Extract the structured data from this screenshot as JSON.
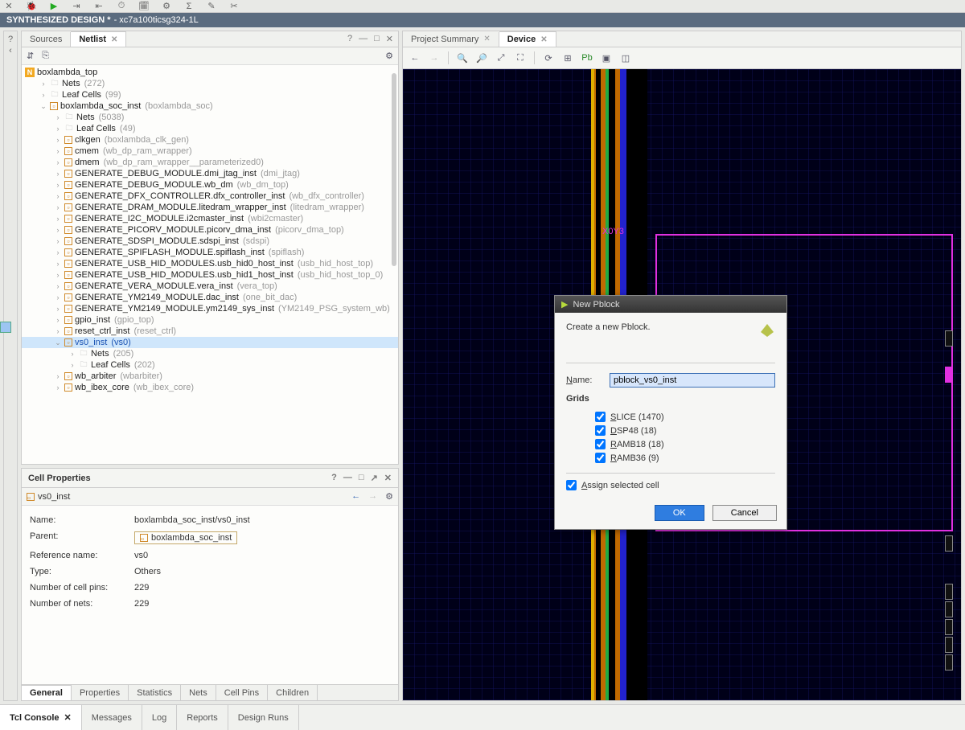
{
  "title": {
    "main": "SYNTHESIZED DESIGN *",
    "sub": "- xc7a100ticsg324-1L"
  },
  "left_tabs": {
    "t0": "Sources",
    "t1": "Netlist"
  },
  "right_tabs": {
    "t0": "Project Summary",
    "t1": "Device"
  },
  "tree": {
    "root": "boxlambda_top",
    "nets": "Nets",
    "nets_c": "(272)",
    "leaf": "Leaf Cells",
    "leaf_c": "(99)",
    "soc": "boxlambda_soc_inst",
    "soc_g": "(boxlambda_soc)",
    "soc_nets": "Nets",
    "soc_nets_c": "(5038)",
    "soc_leaf": "Leaf Cells",
    "soc_leaf_c": "(49)",
    "r0": "clkgen",
    "r0g": "(boxlambda_clk_gen)",
    "r1": "cmem",
    "r1g": "(wb_dp_ram_wrapper)",
    "r2": "dmem",
    "r2g": "(wb_dp_ram_wrapper__parameterized0)",
    "r3": "GENERATE_DEBUG_MODULE.dmi_jtag_inst",
    "r3g": "(dmi_jtag)",
    "r4": "GENERATE_DEBUG_MODULE.wb_dm",
    "r4g": "(wb_dm_top)",
    "r5": "GENERATE_DFX_CONTROLLER.dfx_controller_inst",
    "r5g": "(wb_dfx_controller)",
    "r6": "GENERATE_DRAM_MODULE.litedram_wrapper_inst",
    "r6g": "(litedram_wrapper)",
    "r7": "GENERATE_I2C_MODULE.i2cmaster_inst",
    "r7g": "(wbi2cmaster)",
    "r8": "GENERATE_PICORV_MODULE.picorv_dma_inst",
    "r8g": "(picorv_dma_top)",
    "r9": "GENERATE_SDSPI_MODULE.sdspi_inst",
    "r9g": "(sdspi)",
    "r10": "GENERATE_SPIFLASH_MODULE.spiflash_inst",
    "r10g": "(spiflash)",
    "r11": "GENERATE_USB_HID_MODULES.usb_hid0_host_inst",
    "r11g": "(usb_hid_host_top)",
    "r12": "GENERATE_USB_HID_MODULES.usb_hid1_host_inst",
    "r12g": "(usb_hid_host_top_0)",
    "r13": "GENERATE_VERA_MODULE.vera_inst",
    "r13g": "(vera_top)",
    "r14": "GENERATE_YM2149_MODULE.dac_inst",
    "r14g": "(one_bit_dac)",
    "r15": "GENERATE_YM2149_MODULE.ym2149_sys_inst",
    "r15g": "(YM2149_PSG_system_wb)",
    "r16": "gpio_inst",
    "r16g": "(gpio_top)",
    "r17": "reset_ctrl_inst",
    "r17g": "(reset_ctrl)",
    "r18": "vs0_inst",
    "r18g": "(vs0)",
    "vs_nets": "Nets",
    "vs_nets_c": "(205)",
    "vs_leaf": "Leaf Cells",
    "vs_leaf_c": "(202)",
    "r19": "wb_arbiter",
    "r19g": "(wbarbiter)",
    "r20": "wb_ibex_core",
    "r20g": "(wb_ibex_core)"
  },
  "props": {
    "title": "Cell Properties",
    "inst": "vs0_inst",
    "name_k": "Name:",
    "name_v": "boxlambda_soc_inst/vs0_inst",
    "parent_k": "Parent:",
    "parent_v": "boxlambda_soc_inst",
    "ref_k": "Reference name:",
    "ref_v": "vs0",
    "type_k": "Type:",
    "type_v": "Others",
    "pins_k": "Number of cell pins:",
    "pins_v": "229",
    "nets_k": "Number of nets:",
    "nets_v": "229",
    "tabs": {
      "t0": "General",
      "t1": "Properties",
      "t2": "Statistics",
      "t3": "Nets",
      "t4": "Cell Pins",
      "t5": "Children"
    }
  },
  "device": {
    "clock_lbl": "X0Y3"
  },
  "dialog": {
    "title": "New Pblock",
    "desc": "Create a new Pblock.",
    "name_lbl": "Name:",
    "name_val": "pblock_vs0_inst",
    "grids": "Grids",
    "g0a": "S",
    "g0b": "LICE (1470)",
    "g1a": "D",
    "g1b": "SP48 (18)",
    "g2a": "R",
    "g2b": "AMB18 (18)",
    "g3a": "R",
    "g3b": "AMB36 (9)",
    "assign_a": "A",
    "assign_b": "ssign selected cell",
    "ok": "OK",
    "cancel": "Cancel"
  },
  "bottom": {
    "t0": "Tcl Console",
    "t1": "Messages",
    "t2": "Log",
    "t3": "Reports",
    "t4": "Design Runs"
  }
}
